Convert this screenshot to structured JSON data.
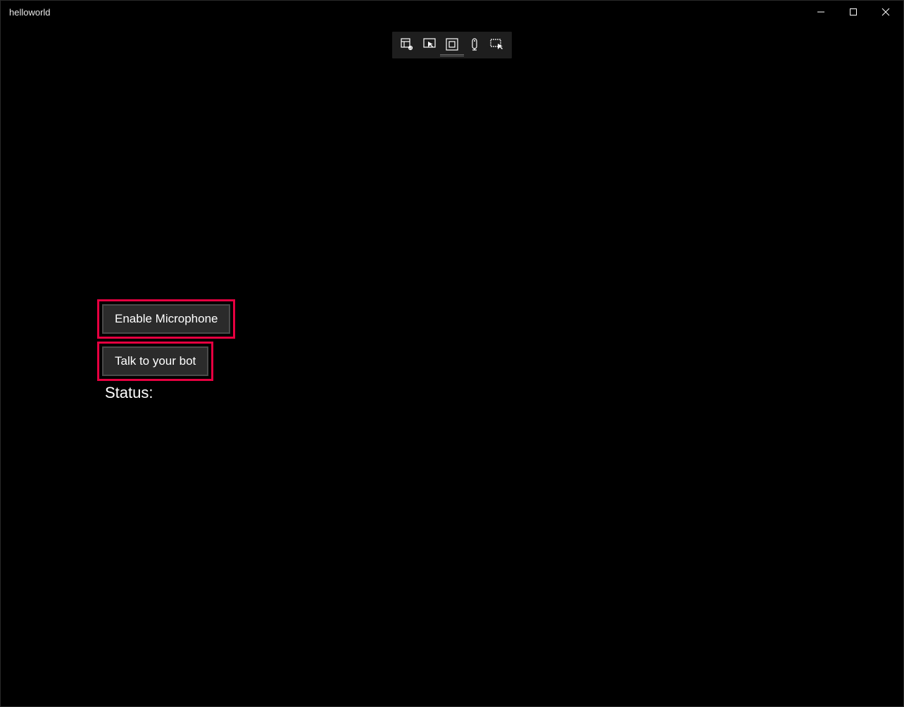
{
  "window": {
    "title": "helloworld"
  },
  "toolbar": {
    "icons": [
      "live-tree-icon",
      "select-element-icon",
      "layout-adorners-icon",
      "hot-reload-icon",
      "display-options-icon"
    ]
  },
  "buttons": {
    "enable_microphone": "Enable Microphone",
    "talk_to_bot": "Talk to your bot"
  },
  "labels": {
    "status": "Status:"
  },
  "highlight_color": "#e60040"
}
